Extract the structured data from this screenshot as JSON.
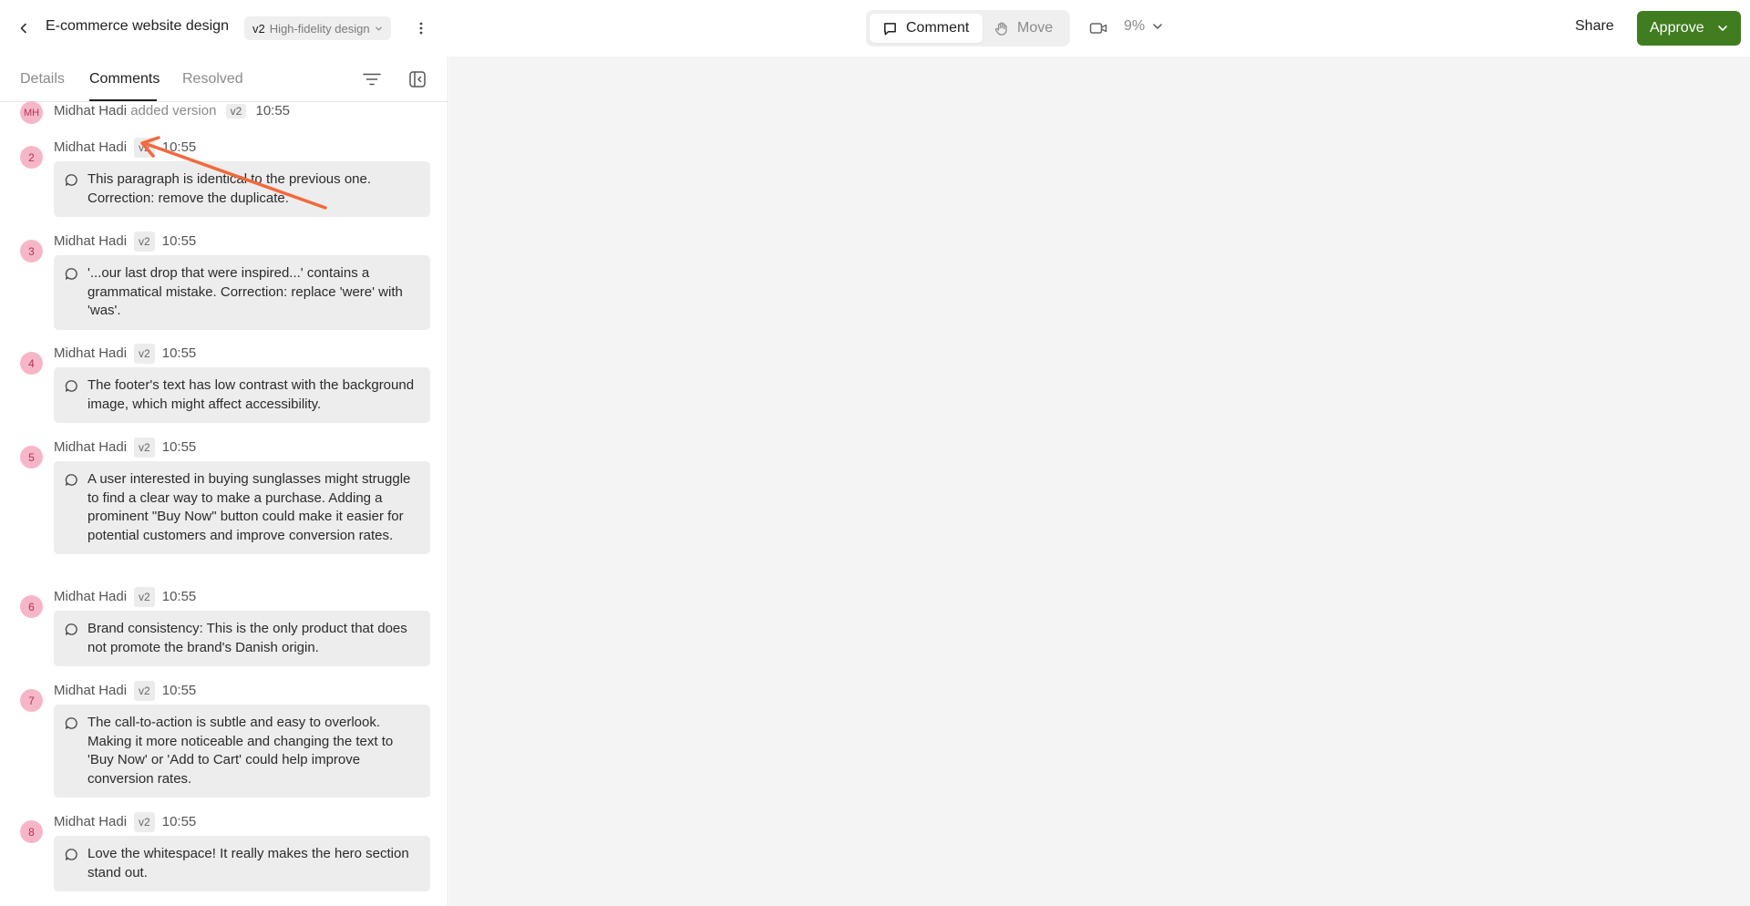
{
  "header": {
    "title": "E-commerce website design",
    "version": {
      "num": "v2",
      "label": "High-fidelity design"
    },
    "modes": {
      "comment": "Comment",
      "move": "Move"
    },
    "zoom": "9%",
    "share": "Share",
    "approve": "Approve"
  },
  "sidebar": {
    "tabs": {
      "details": "Details",
      "comments": "Comments",
      "resolved": "Resolved"
    },
    "activity": {
      "initials": "MH",
      "name": "Midhat Hadi",
      "text": "added version",
      "version": "v2",
      "time": "10:55"
    },
    "comments": [
      {
        "num": "2",
        "name": "Midhat Hadi",
        "version": "v2",
        "time": "10:55",
        "text": "This paragraph is identical to the previous one. Correction: remove the duplicate."
      },
      {
        "num": "3",
        "name": "Midhat Hadi",
        "version": "v2",
        "time": "10:55",
        "text": "'...our last drop that were inspired...' contains a grammatical mistake. Correction: replace 'were' with 'was'."
      },
      {
        "num": "4",
        "name": "Midhat Hadi",
        "version": "v2",
        "time": "10:55",
        "text": "The footer's text has low contrast with the background image, which might affect accessibility."
      },
      {
        "num": "5",
        "name": "Midhat Hadi",
        "version": "v2",
        "time": "10:55",
        "text": "A user interested in buying sunglasses might struggle to find a clear way to make a purchase. Adding a prominent \"Buy Now\" button could make it easier for potential customers and improve conversion rates."
      },
      {
        "num": "6",
        "name": "Midhat Hadi",
        "version": "v2",
        "time": "10:55",
        "text": "Brand consistency: This is the only product that does not promote the brand's Danish origin."
      },
      {
        "num": "7",
        "name": "Midhat Hadi",
        "version": "v2",
        "time": "10:55",
        "text": "The call-to-action is subtle and easy to overlook. Making it more noticeable and changing the text to 'Buy Now' or 'Add to Cart' could help improve conversion rates."
      },
      {
        "num": "8",
        "name": "Midhat Hadi",
        "version": "v2",
        "time": "10:55",
        "text": "Love the whitespace! It really makes the hero section stand out."
      }
    ]
  },
  "colors": {
    "approve": "#3f7d20",
    "badge_bg": "#f7b6c8",
    "badge_fg": "#b23259",
    "annotation_arrow": "#f26a3d",
    "canvas_bg": "#f4f4f5"
  },
  "icons": {
    "back": "chevron-left-icon",
    "version_dropdown": "chevron-down-icon",
    "more": "more-vertical-icon",
    "comment_mode": "comment-icon",
    "move_mode": "hand-icon",
    "camera": "video-camera-icon",
    "zoom_dropdown": "chevron-down-icon",
    "approve_dropdown": "chevron-down-icon",
    "filter": "filter-icon",
    "collapse": "collapse-panel-icon",
    "comment_bubble": "speech-bubble-icon"
  }
}
